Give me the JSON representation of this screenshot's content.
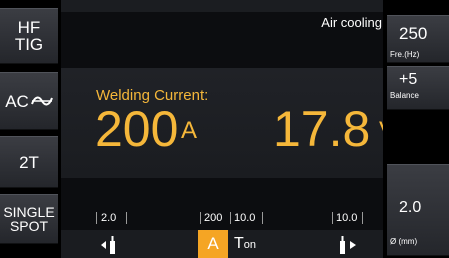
{
  "left_buttons": [
    {
      "line1": "HF",
      "line2": "TIG"
    },
    {
      "label": "AC",
      "icon": "ac-wave-icon"
    },
    {
      "label": "2T"
    },
    {
      "line1": "SINGLE",
      "line2": "SPOT"
    }
  ],
  "status": {
    "cooling": "Air cooling"
  },
  "main": {
    "current_label": "Welding Current:",
    "current_value": "200",
    "current_unit": "A",
    "voltage_value": "17.8",
    "voltage_unit": "V"
  },
  "right_panel": {
    "frequency": {
      "value": "250",
      "label": "Fre.(Hz)"
    },
    "balance": {
      "value": "+5",
      "label": "Balance"
    },
    "diameter": {
      "value": "2.0",
      "label": "Ø (mm)"
    }
  },
  "params": [
    "2.0",
    "200",
    "10.0",
    "10.0"
  ],
  "bottom": {
    "a_label": "A",
    "ton_t": "T",
    "ton_sub": "on"
  },
  "colors": {
    "accent": "#f5b73a",
    "active": "#f5a524",
    "bg": "#0c0d10"
  }
}
